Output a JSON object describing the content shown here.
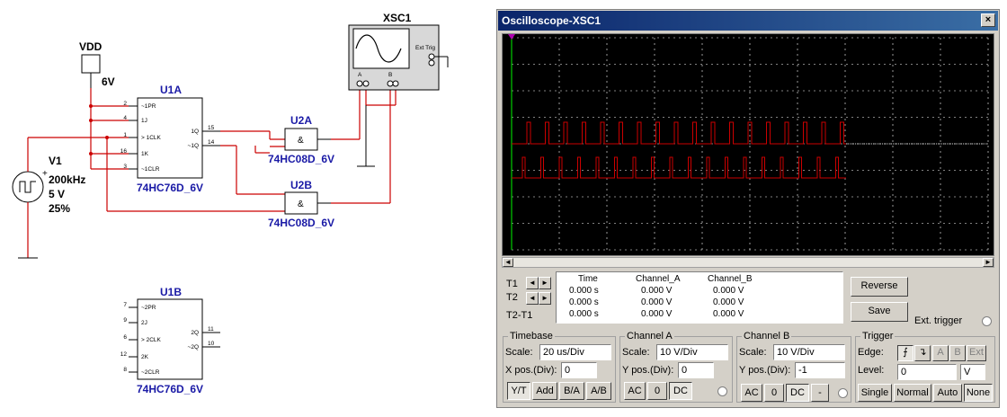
{
  "schematic": {
    "vdd": {
      "label": "VDD",
      "value": "6V"
    },
    "source": {
      "ref": "V1",
      "freq": "200kHz",
      "amp": "5 V",
      "duty": "25%"
    },
    "u1a": {
      "ref": "U1A",
      "part": "74HC76D_6V",
      "pins_left": [
        "~1PR",
        "1J",
        "1CLK",
        "1K",
        "~1CLR"
      ],
      "pin_nums_left": [
        "2",
        "4",
        "1",
        "16",
        "3"
      ],
      "pins_right": [
        "1Q",
        "~1Q"
      ],
      "pin_nums_right": [
        "15",
        "14"
      ]
    },
    "u1b": {
      "ref": "U1B",
      "part": "74HC76D_6V",
      "pins_left": [
        "~2PR",
        "2J",
        "2CLK",
        "2K",
        "~2CLR"
      ],
      "pin_nums_left": [
        "7",
        "9",
        "6",
        "12",
        "8"
      ],
      "pins_right": [
        "2Q",
        "~2Q"
      ],
      "pin_nums_right": [
        "11",
        "10"
      ]
    },
    "u2a": {
      "ref": "U2A",
      "part": "74HC08D_6V",
      "symbol": "&"
    },
    "u2b": {
      "ref": "U2B",
      "part": "74HC08D_6V",
      "symbol": "&"
    },
    "xsc": {
      "ref": "XSC1",
      "ext_trig": "Ext Trig",
      "ch_a": "A",
      "ch_b": "B"
    }
  },
  "scope": {
    "title": "Oscilloscope-XSC1",
    "close": "×",
    "measure": {
      "t1": "T1",
      "t2": "T2",
      "t2t1": "T2-T1",
      "headers": [
        "Time",
        "Channel_A",
        "Channel_B"
      ],
      "rows": [
        [
          "0.000 s",
          "0.000 V",
          "0.000 V"
        ],
        [
          "0.000 s",
          "0.000 V",
          "0.000 V"
        ],
        [
          "0.000 s",
          "0.000 V",
          "0.000 V"
        ]
      ]
    },
    "reverse": "Reverse",
    "save": "Save",
    "ext_trigger": "Ext. trigger",
    "timebase": {
      "title": "Timebase",
      "scale_label": "Scale:",
      "scale": "20 us/Div",
      "xpos_label": "X pos.(Div):",
      "xpos": "0",
      "buttons": [
        "Y/T",
        "Add",
        "B/A",
        "A/B"
      ]
    },
    "channel_a": {
      "title": "Channel A",
      "scale_label": "Scale:",
      "scale": "10  V/Div",
      "ypos_label": "Y pos.(Div):",
      "ypos": "0",
      "buttons": [
        "AC",
        "0",
        "DC"
      ]
    },
    "channel_b": {
      "title": "Channel B",
      "scale_label": "Scale:",
      "scale": "10  V/Div",
      "ypos_label": "Y pos.(Div):",
      "ypos": "-1",
      "buttons": [
        "AC",
        "0",
        "DC",
        "-"
      ]
    },
    "trigger": {
      "title": "Trigger",
      "edge_label": "Edge:",
      "level_label": "Level:",
      "level": "0",
      "level_unit": "V",
      "sources": [
        "A",
        "B",
        "Ext"
      ],
      "modes": [
        "Single",
        "Normal",
        "Auto",
        "None"
      ]
    },
    "colors": {
      "trace": "#cc0000",
      "grid": "#ffffff",
      "background": "#000000",
      "cursor": "#00cc00"
    }
  }
}
